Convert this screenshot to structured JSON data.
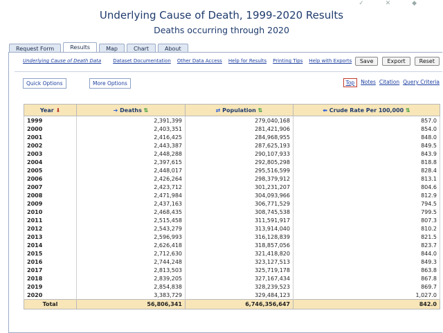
{
  "header": {
    "title": "Underlying Cause of Death, 1999-2020 Results",
    "subtitle": "Deaths occurring through 2020"
  },
  "tabs": [
    "Request Form",
    "Results",
    "Map",
    "Chart",
    "About"
  ],
  "active_tab": "Results",
  "links": [
    "Underlying Cause of Death Data",
    "Dataset Documentation",
    "Other Data Access",
    "Help for Results",
    "Printing Tips",
    "Help with Exports"
  ],
  "buttons": {
    "save": "Save",
    "export": "Export",
    "reset": "Reset"
  },
  "options": {
    "quick": "Quick Options",
    "more": "More Options"
  },
  "right_links": {
    "top": "Top",
    "notes": "Notes",
    "citation": "Citation",
    "query": "Query Criteria"
  },
  "table": {
    "headers": {
      "year": "Year",
      "deaths": "Deaths",
      "population": "Population",
      "rate": "Crude Rate Per 100,000"
    },
    "rows": [
      {
        "year": "1999",
        "deaths": "2,391,399",
        "population": "279,040,168",
        "rate": "857.0"
      },
      {
        "year": "2000",
        "deaths": "2,403,351",
        "population": "281,421,906",
        "rate": "854.0"
      },
      {
        "year": "2001",
        "deaths": "2,416,425",
        "population": "284,968,955",
        "rate": "848.0"
      },
      {
        "year": "2002",
        "deaths": "2,443,387",
        "population": "287,625,193",
        "rate": "849.5"
      },
      {
        "year": "2003",
        "deaths": "2,448,288",
        "population": "290,107,933",
        "rate": "843.9"
      },
      {
        "year": "2004",
        "deaths": "2,397,615",
        "population": "292,805,298",
        "rate": "818.8"
      },
      {
        "year": "2005",
        "deaths": "2,448,017",
        "population": "295,516,599",
        "rate": "828.4"
      },
      {
        "year": "2006",
        "deaths": "2,426,264",
        "population": "298,379,912",
        "rate": "813.1"
      },
      {
        "year": "2007",
        "deaths": "2,423,712",
        "population": "301,231,207",
        "rate": "804.6"
      },
      {
        "year": "2008",
        "deaths": "2,471,984",
        "population": "304,093,966",
        "rate": "812.9"
      },
      {
        "year": "2009",
        "deaths": "2,437,163",
        "population": "306,771,529",
        "rate": "794.5"
      },
      {
        "year": "2010",
        "deaths": "2,468,435",
        "population": "308,745,538",
        "rate": "799.5"
      },
      {
        "year": "2011",
        "deaths": "2,515,458",
        "population": "311,591,917",
        "rate": "807.3"
      },
      {
        "year": "2012",
        "deaths": "2,543,279",
        "population": "313,914,040",
        "rate": "810.2"
      },
      {
        "year": "2013",
        "deaths": "2,596,993",
        "population": "316,128,839",
        "rate": "821.5"
      },
      {
        "year": "2014",
        "deaths": "2,626,418",
        "population": "318,857,056",
        "rate": "823.7"
      },
      {
        "year": "2015",
        "deaths": "2,712,630",
        "population": "321,418,820",
        "rate": "844.0"
      },
      {
        "year": "2016",
        "deaths": "2,744,248",
        "population": "323,127,513",
        "rate": "849.3"
      },
      {
        "year": "2017",
        "deaths": "2,813,503",
        "population": "325,719,178",
        "rate": "863.8"
      },
      {
        "year": "2018",
        "deaths": "2,839,205",
        "population": "327,167,434",
        "rate": "867.8"
      },
      {
        "year": "2019",
        "deaths": "2,854,838",
        "population": "328,239,523",
        "rate": "869.7"
      },
      {
        "year": "2020",
        "deaths": "3,383,729",
        "population": "329,484,123",
        "rate": "1,027.0"
      }
    ],
    "total": {
      "label": "Total",
      "deaths": "56,806,341",
      "population": "6,746,356,647",
      "rate": "842.0"
    }
  },
  "colors": {
    "header_bg": "#f8e6b8",
    "link": "#1c3fa0",
    "title": "#1f3b6d"
  }
}
